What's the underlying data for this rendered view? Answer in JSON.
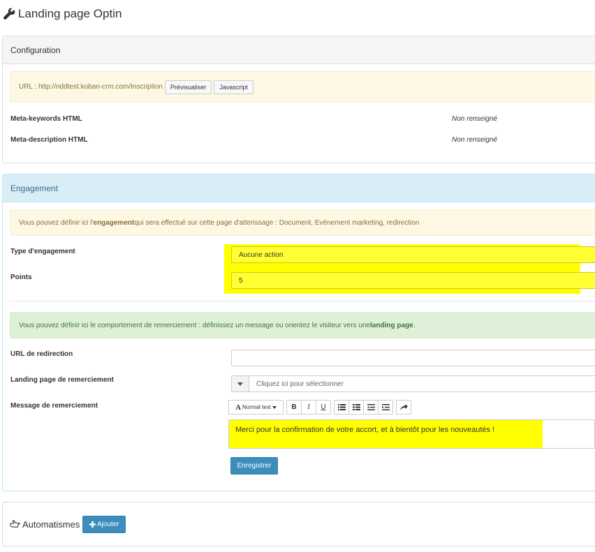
{
  "header": {
    "title": "Landing page Optin",
    "icon": "wrench-icon"
  },
  "configuration": {
    "title": "Configuration",
    "url_label": "URL : http://nddtest.koban-crm.com/Inscription",
    "preview_button": "Prévisualiser",
    "javascript_button": "Javascript",
    "meta_keywords_label": "Meta-keywords HTML",
    "meta_keywords_value": "Non renseigné",
    "meta_description_label": "Meta-description HTML",
    "meta_description_value": "Non renseigné"
  },
  "engagement": {
    "title": "Engagement",
    "info_prefix": "Vous pouvez définir ici l'",
    "info_bold": "engagement",
    "info_suffix": " qui sera effectué sur cette page d'atterissage : Document, Evènement marketing, redirection",
    "type_label": "Type d'engagement",
    "type_value": "Aucune action",
    "points_label": "Points",
    "points_value": "5",
    "thanks_prefix": "Vous pouvez définir ici le comportement de remerciement : définissez un message ou orientez le visiteur vers une ",
    "thanks_bold": "landing page",
    "thanks_suffix": ".",
    "redirect_label": "URL de redirection",
    "redirect_value": "",
    "thanks_page_label": "Landing page de remerciement",
    "thanks_page_placeholder": "Cliquez ici pour sélectionner",
    "thanks_message_label": "Message de remerciement",
    "toolbar": {
      "font_label": "Normal text",
      "bold": "B",
      "italic": "I",
      "underline": "U"
    },
    "thanks_message_value": "Merci pour la confirmation de votre accort, et à bientôt pour les nouveautés !",
    "save_button": "Enregistrer"
  },
  "automatismes": {
    "title": "Automatismes",
    "add_button": "Ajouter"
  },
  "colors": {
    "highlight": "#ffff00",
    "primary": "#3c8dbc",
    "info_heading": "#d9edf7"
  }
}
